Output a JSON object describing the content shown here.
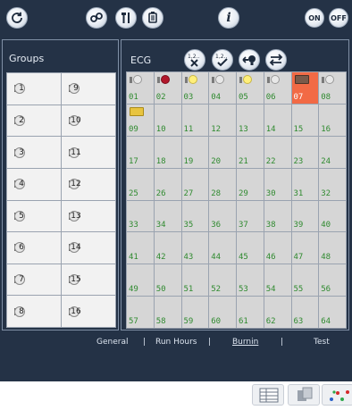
{
  "toolbar": {
    "on_label": "ON",
    "off_label": "OFF",
    "info_label": "i"
  },
  "groups": {
    "title": "Groups",
    "left_col": [
      "1",
      "2",
      "3",
      "4",
      "5",
      "6",
      "7",
      "8"
    ],
    "right_col": [
      "9",
      "10",
      "11",
      "12",
      "13",
      "14",
      "15",
      "16"
    ]
  },
  "ecg": {
    "title": "ECG",
    "btn_clear_label": "1,2..",
    "btn_check_label": "1,2..",
    "tiles": [
      {
        "n": "01",
        "icon": "plug"
      },
      {
        "n": "02",
        "icon": "plug-red"
      },
      {
        "n": "03",
        "icon": "plug-yellow"
      },
      {
        "n": "04",
        "icon": "plug"
      },
      {
        "n": "05",
        "icon": "plug-yellow"
      },
      {
        "n": "06",
        "icon": "plug"
      },
      {
        "n": "07",
        "icon": "battery-dark",
        "selected": true
      },
      {
        "n": "08",
        "icon": "plug"
      },
      {
        "n": "09",
        "icon": "battery"
      },
      {
        "n": "10"
      },
      {
        "n": "11"
      },
      {
        "n": "12"
      },
      {
        "n": "13"
      },
      {
        "n": "14"
      },
      {
        "n": "15"
      },
      {
        "n": "16"
      },
      {
        "n": "17"
      },
      {
        "n": "18"
      },
      {
        "n": "19"
      },
      {
        "n": "20"
      },
      {
        "n": "21"
      },
      {
        "n": "22"
      },
      {
        "n": "23"
      },
      {
        "n": "24"
      },
      {
        "n": "25"
      },
      {
        "n": "26"
      },
      {
        "n": "27"
      },
      {
        "n": "28"
      },
      {
        "n": "29"
      },
      {
        "n": "30"
      },
      {
        "n": "31"
      },
      {
        "n": "32"
      },
      {
        "n": "33"
      },
      {
        "n": "34"
      },
      {
        "n": "35"
      },
      {
        "n": "36"
      },
      {
        "n": "37"
      },
      {
        "n": "38"
      },
      {
        "n": "39"
      },
      {
        "n": "40"
      },
      {
        "n": "41"
      },
      {
        "n": "42"
      },
      {
        "n": "43"
      },
      {
        "n": "44"
      },
      {
        "n": "45"
      },
      {
        "n": "46"
      },
      {
        "n": "47"
      },
      {
        "n": "48"
      },
      {
        "n": "49"
      },
      {
        "n": "50"
      },
      {
        "n": "51"
      },
      {
        "n": "52"
      },
      {
        "n": "53"
      },
      {
        "n": "54"
      },
      {
        "n": "55"
      },
      {
        "n": "56"
      },
      {
        "n": "57"
      },
      {
        "n": "58"
      },
      {
        "n": "59"
      },
      {
        "n": "60"
      },
      {
        "n": "61"
      },
      {
        "n": "62"
      },
      {
        "n": "63"
      },
      {
        "n": "64"
      }
    ]
  },
  "tabs": {
    "general": "General",
    "sep1": "|",
    "run_hours": "Run Hours",
    "sep2": "|",
    "burnin": "Burnin",
    "sep3": "|",
    "test": "Test",
    "active": "Burnin"
  },
  "colors": {
    "background": "#243246",
    "tile": "#d6d6d6",
    "tile_selected": "#f26a45",
    "tile_number": "#2f8a2f"
  },
  "icons": {
    "refresh": "refresh-icon",
    "link": "link-icon",
    "tools": "tools-icon",
    "trash": "trash-icon",
    "info": "info-icon",
    "plug": "plug-icon",
    "battery": "battery-icon"
  }
}
